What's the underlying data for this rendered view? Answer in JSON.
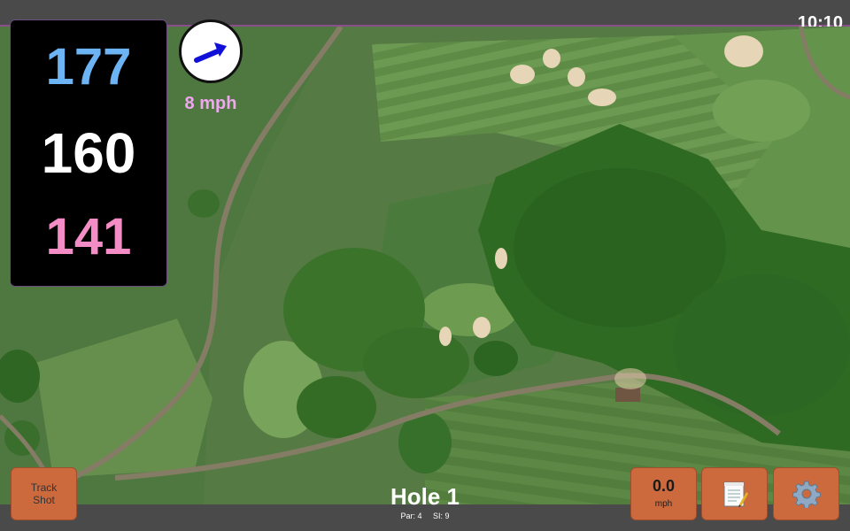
{
  "status": {
    "time": "10:10"
  },
  "yardages": {
    "back": "177",
    "middle": "160",
    "front": "141"
  },
  "colors": {
    "back": "#6db4f4",
    "middle": "#ffffff",
    "front": "#f48cc6",
    "wind_text": "#f0a6f0",
    "wind_arrow": "#1010d8",
    "button": "#cc6a3e"
  },
  "wind": {
    "speed": "8 mph",
    "icon": "wind-direction-arrow-icon"
  },
  "hole": {
    "title": "Hole 1",
    "par": "Par: 4",
    "si": "SI: 9"
  },
  "buttons": {
    "track_line1": "Track",
    "track_line2": "Shot",
    "speed_value": "0.0",
    "speed_unit": "mph",
    "notes_icon": "notepad-icon",
    "settings_icon": "gear-icon"
  }
}
